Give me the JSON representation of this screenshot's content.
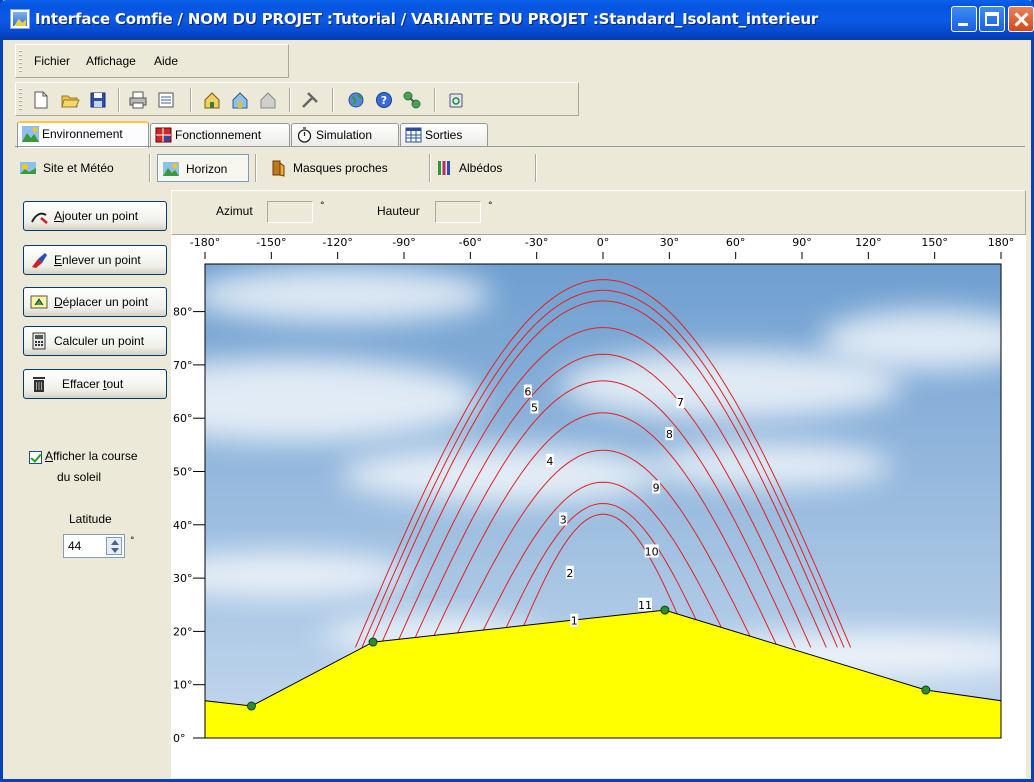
{
  "window": {
    "title": "Interface Comfie  /  NOM DU PROJET :Tutorial  /  VARIANTE DU PROJET :Standard_Isolant_interieur",
    "controls": [
      "minimize",
      "maximize",
      "close"
    ]
  },
  "menu": {
    "items": [
      "Fichier",
      "Affichage",
      "Aide"
    ]
  },
  "toolbar": {
    "icons": [
      "new-file-icon",
      "open-folder-icon",
      "save-icon",
      "print-icon",
      "list-icon",
      "house-edit-icon",
      "house-icon",
      "building-icon",
      "tools-icon",
      "globe-icon",
      "help-icon",
      "network-icon",
      "recycle-icon"
    ]
  },
  "tabs": [
    {
      "label": "Environnement",
      "active": true,
      "icon": "environment-icon"
    },
    {
      "label": "Fonctionnement",
      "active": false,
      "icon": "grid-icon"
    },
    {
      "label": "Simulation",
      "active": false,
      "icon": "stopwatch-icon"
    },
    {
      "label": "Sorties",
      "active": false,
      "icon": "table-icon"
    }
  ],
  "subtabs": [
    {
      "label": "Site et Météo",
      "active": false,
      "icon": "weather-icon"
    },
    {
      "label": "Horizon",
      "active": true,
      "icon": "horizon-icon"
    },
    {
      "label": "Masques proches",
      "active": false,
      "icon": "mask-icon"
    },
    {
      "label": "Albédos",
      "active": false,
      "icon": "albedo-icon"
    }
  ],
  "actions": {
    "add": {
      "prefix": "",
      "key": "A",
      "rest": "jouter un point"
    },
    "remove": {
      "prefix": "",
      "key": "E",
      "rest": "nlever un point"
    },
    "move": {
      "prefix": "",
      "key": "D",
      "rest": "éplacer un point"
    },
    "compute": {
      "label": "Calculer un point"
    },
    "clear": {
      "prefix": "Effacer ",
      "key": "t",
      "rest": "out"
    }
  },
  "sun_course": {
    "checked": true,
    "label_key": "A",
    "label_rest": "fficher la course",
    "label_line2": "du soleil"
  },
  "latitude": {
    "label": "Latitude",
    "value": "44",
    "unit": "°"
  },
  "strip": {
    "azimut_label": "Azimut",
    "azimut_value": "",
    "hauteur_label": "Hauteur",
    "hauteur_value": "",
    "unit": "°"
  },
  "colors": {
    "ground": "#ffff00",
    "sun_path": "#e02020",
    "point": "#2e8b2e",
    "sky_top": "#6f9fd0",
    "sky_bottom": "#c4d8ee"
  },
  "chart_data": {
    "type": "line",
    "xlabel": "",
    "ylabel": "",
    "x_ticks": [
      "-180°",
      "-150°",
      "-120°",
      "-90°",
      "-60°",
      "-30°",
      "0°",
      "30°",
      "60°",
      "90°",
      "120°",
      "150°",
      "180°"
    ],
    "y_ticks": [
      "0°",
      "10°",
      "20°",
      "30°",
      "40°",
      "50°",
      "60°",
      "70°",
      "80°"
    ],
    "xlim": [
      -180,
      180
    ],
    "ylim": [
      -3,
      85
    ],
    "horizon_points": [
      {
        "az": -180,
        "h": 7
      },
      {
        "az": -159,
        "h": 6
      },
      {
        "az": -104,
        "h": 18
      },
      {
        "az": 28,
        "h": 24
      },
      {
        "az": 146,
        "h": 9
      },
      {
        "az": 180,
        "h": 7
      }
    ],
    "marked_points": [
      {
        "az": -159,
        "h": 6
      },
      {
        "az": -104,
        "h": 18
      },
      {
        "az": 28,
        "h": 24
      },
      {
        "az": 146,
        "h": 9
      }
    ],
    "sun_paths": [
      {
        "max": 25,
        "half_width": 40
      },
      {
        "max": 27,
        "half_width": 48
      },
      {
        "max": 31,
        "half_width": 58
      },
      {
        "max": 37,
        "half_width": 69
      },
      {
        "max": 44,
        "half_width": 79
      },
      {
        "max": 50,
        "half_width": 87
      },
      {
        "max": 55,
        "half_width": 94
      },
      {
        "max": 60,
        "half_width": 101
      },
      {
        "max": 65,
        "half_width": 106
      },
      {
        "max": 67,
        "half_width": 109
      },
      {
        "max": 69,
        "half_width": 112
      }
    ],
    "path_labels": [
      {
        "text": "1",
        "az": -13,
        "h": 22
      },
      {
        "text": "2",
        "az": -15,
        "h": 31
      },
      {
        "text": "3",
        "az": -18,
        "h": 41
      },
      {
        "text": "4",
        "az": -24,
        "h": 52
      },
      {
        "text": "5",
        "az": -31,
        "h": 62
      },
      {
        "text": "6",
        "az": -34,
        "h": 65
      },
      {
        "text": "7",
        "az": 35,
        "h": 63
      },
      {
        "text": "8",
        "az": 30,
        "h": 57
      },
      {
        "text": "9",
        "az": 24,
        "h": 47
      },
      {
        "text": "10",
        "az": 22,
        "h": 35
      },
      {
        "text": "11",
        "az": 19,
        "h": 25
      }
    ]
  }
}
